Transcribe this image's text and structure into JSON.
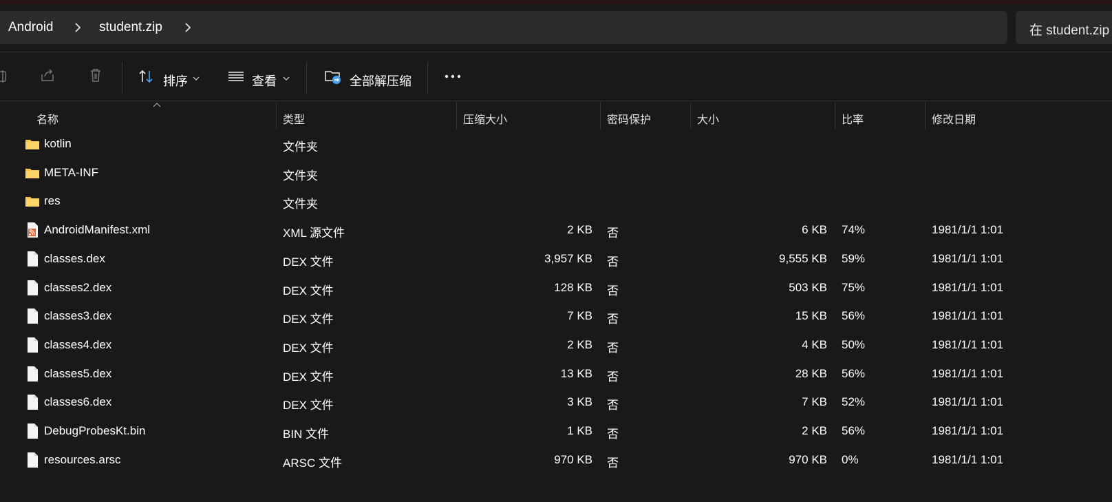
{
  "address": {
    "crumbs": [
      "Android",
      "student.zip"
    ]
  },
  "search": {
    "text": "在 student.zip"
  },
  "toolbar": {
    "sort_label": "排序",
    "view_label": "查看",
    "extract_all_label": "全部解压缩"
  },
  "columns": {
    "name": "名称",
    "type": "类型",
    "compressed_size": "压缩大小",
    "password_protected": "密码保护",
    "size": "大小",
    "ratio": "比率",
    "modified": "修改日期"
  },
  "files": [
    {
      "name": "kotlin",
      "icon": "folder-icon",
      "type": "文件夹",
      "compressed": "",
      "password": "",
      "size": "",
      "ratio": "",
      "modified": ""
    },
    {
      "name": "META-INF",
      "icon": "folder-icon",
      "type": "文件夹",
      "compressed": "",
      "password": "",
      "size": "",
      "ratio": "",
      "modified": ""
    },
    {
      "name": "res",
      "icon": "folder-icon",
      "type": "文件夹",
      "compressed": "",
      "password": "",
      "size": "",
      "ratio": "",
      "modified": ""
    },
    {
      "name": "AndroidManifest.xml",
      "icon": "xml-file-icon",
      "type": "XML 源文件",
      "compressed": "2 KB",
      "password": "否",
      "size": "6 KB",
      "ratio": "74%",
      "modified": "1981/1/1 1:01"
    },
    {
      "name": "classes.dex",
      "icon": "file-icon",
      "type": "DEX 文件",
      "compressed": "3,957 KB",
      "password": "否",
      "size": "9,555 KB",
      "ratio": "59%",
      "modified": "1981/1/1 1:01"
    },
    {
      "name": "classes2.dex",
      "icon": "file-icon",
      "type": "DEX 文件",
      "compressed": "128 KB",
      "password": "否",
      "size": "503 KB",
      "ratio": "75%",
      "modified": "1981/1/1 1:01"
    },
    {
      "name": "classes3.dex",
      "icon": "file-icon",
      "type": "DEX 文件",
      "compressed": "7 KB",
      "password": "否",
      "size": "15 KB",
      "ratio": "56%",
      "modified": "1981/1/1 1:01"
    },
    {
      "name": "classes4.dex",
      "icon": "file-icon",
      "type": "DEX 文件",
      "compressed": "2 KB",
      "password": "否",
      "size": "4 KB",
      "ratio": "50%",
      "modified": "1981/1/1 1:01"
    },
    {
      "name": "classes5.dex",
      "icon": "file-icon",
      "type": "DEX 文件",
      "compressed": "13 KB",
      "password": "否",
      "size": "28 KB",
      "ratio": "56%",
      "modified": "1981/1/1 1:01"
    },
    {
      "name": "classes6.dex",
      "icon": "file-icon",
      "type": "DEX 文件",
      "compressed": "3 KB",
      "password": "否",
      "size": "7 KB",
      "ratio": "52%",
      "modified": "1981/1/1 1:01"
    },
    {
      "name": "DebugProbesKt.bin",
      "icon": "file-icon",
      "type": "BIN 文件",
      "compressed": "1 KB",
      "password": "否",
      "size": "2 KB",
      "ratio": "56%",
      "modified": "1981/1/1 1:01"
    },
    {
      "name": "resources.arsc",
      "icon": "file-icon",
      "type": "ARSC 文件",
      "compressed": "970 KB",
      "password": "否",
      "size": "970 KB",
      "ratio": "0%",
      "modified": "1981/1/1 1:01"
    }
  ],
  "colors": {
    "background": "#191919",
    "folder": "#f6c34a",
    "accent": "#4aa3f0"
  }
}
